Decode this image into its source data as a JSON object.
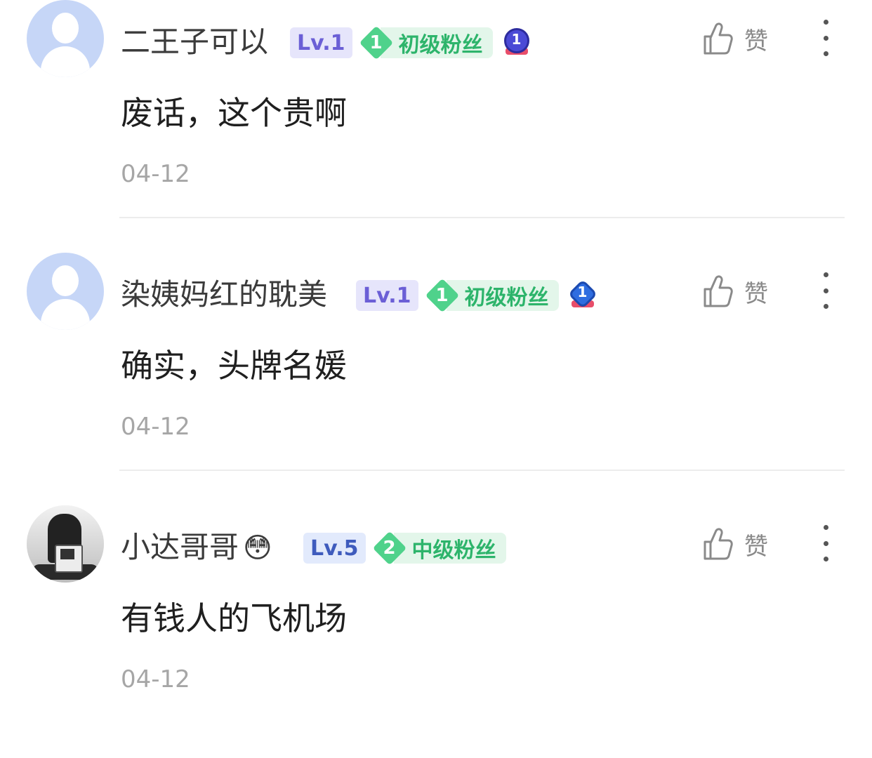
{
  "like_label": "赞",
  "comments": [
    {
      "username": "二王子可以",
      "level": "Lv.1",
      "fan_level": "1",
      "fan_title": "初级粉丝",
      "medal_num": "1",
      "content": "废话，这个贵啊",
      "date": "04-12"
    },
    {
      "username": "染姨妈红的耽美",
      "level": "Lv.1",
      "fan_level": "1",
      "fan_title": "初级粉丝",
      "medal_num": "1",
      "content": "确实，头牌名媛",
      "date": "04-12"
    },
    {
      "username": "小达哥哥",
      "username_emoji": "😳",
      "level": "Lv.5",
      "fan_level": "2",
      "fan_title": "中级粉丝",
      "content": "有钱人的飞机场",
      "date": "04-12"
    }
  ]
}
